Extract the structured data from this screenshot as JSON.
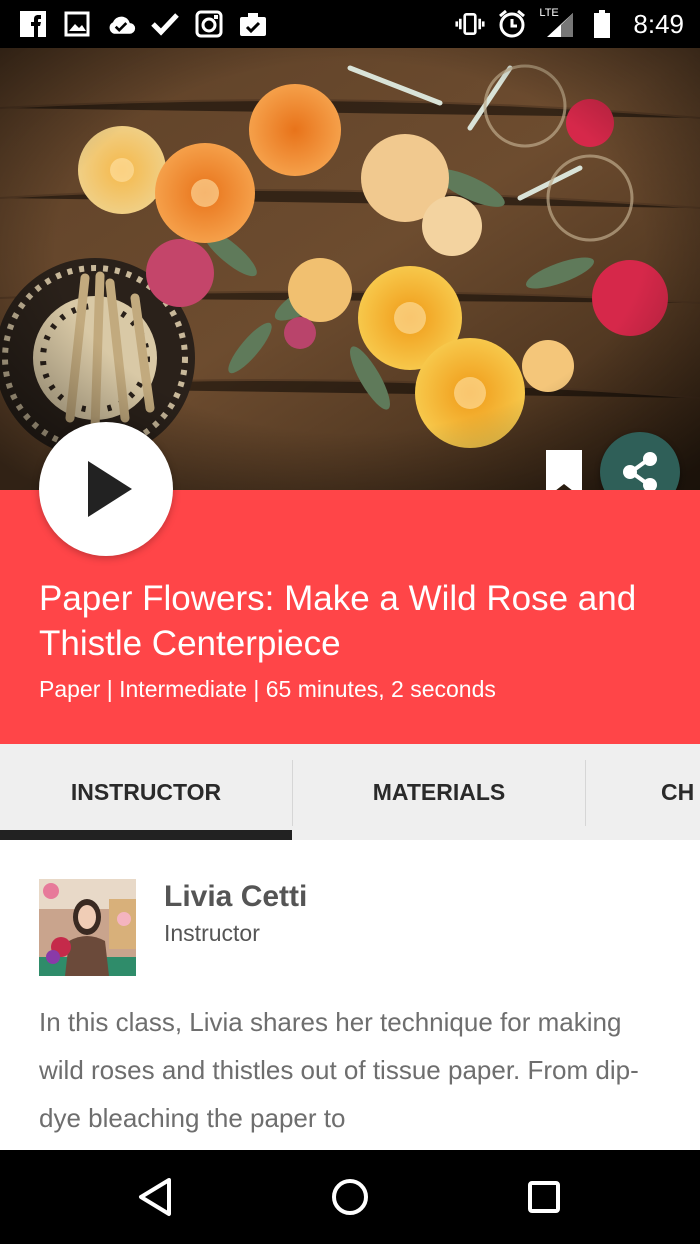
{
  "status_bar": {
    "time": "8:49",
    "network": "LTE",
    "left_icons": [
      "facebook-icon",
      "image-icon",
      "cloud-check-icon",
      "checkmark-icon",
      "instagram-icon",
      "clipboard-check-icon"
    ],
    "right_icons": [
      "vibrate-icon",
      "alarm-icon",
      "signal-icon",
      "battery-icon"
    ]
  },
  "hero": {
    "play_icon": "play-icon",
    "bookmark_icon": "bookmark-icon",
    "share_icon": "share-icon"
  },
  "class_info": {
    "title": "Paper Flowers: Make a Wild Rose and Thistle Centerpiece",
    "meta": "Paper | Intermediate | 65 minutes, 2 seconds"
  },
  "tabs": [
    {
      "label": "INSTRUCTOR",
      "active": true
    },
    {
      "label": "MATERIALS",
      "active": false
    },
    {
      "label": "CH",
      "active": false
    }
  ],
  "instructor": {
    "name": "Livia Cetti",
    "role": "Instructor",
    "description": "In this class, Livia shares her technique for making wild roses and thistles out of tissue paper. From dip-dye bleaching the paper to"
  },
  "nav_bar": {
    "back_icon": "back-icon",
    "home_icon": "home-icon",
    "recents_icon": "recents-icon"
  },
  "colors": {
    "banner": "#ff4548",
    "tabs_bg": "#efefef",
    "share_bg": "#2f5f58"
  }
}
